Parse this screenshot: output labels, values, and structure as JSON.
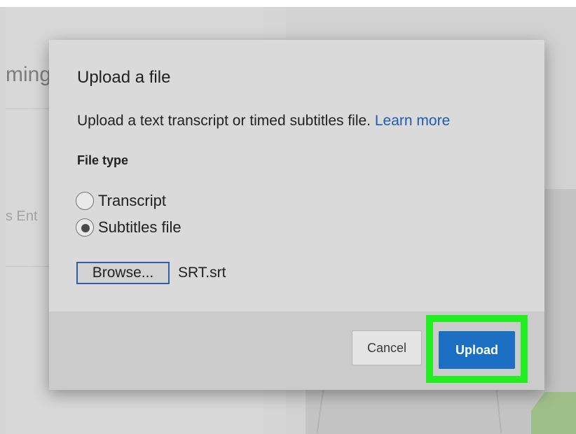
{
  "background": {
    "title_fragment": "ming",
    "input_fragment": "s Ent",
    "bottom_fragment": "",
    "accent_color": "#e4a3a3"
  },
  "dialog": {
    "title": "Upload a file",
    "description": "Upload a text transcript or timed subtitles file.",
    "learn_more": "Learn more",
    "file_type_label": "File type",
    "options": [
      {
        "label": "Transcript",
        "selected": false
      },
      {
        "label": "Subtitles file",
        "selected": true
      }
    ],
    "browse_label": "Browse...",
    "file_name": "SRT.srt",
    "cancel_label": "Cancel",
    "upload_label": "Upload"
  },
  "colors": {
    "primary_button": "#1c70c4",
    "link": "#1e5cb3",
    "highlight": "#22ee22"
  }
}
